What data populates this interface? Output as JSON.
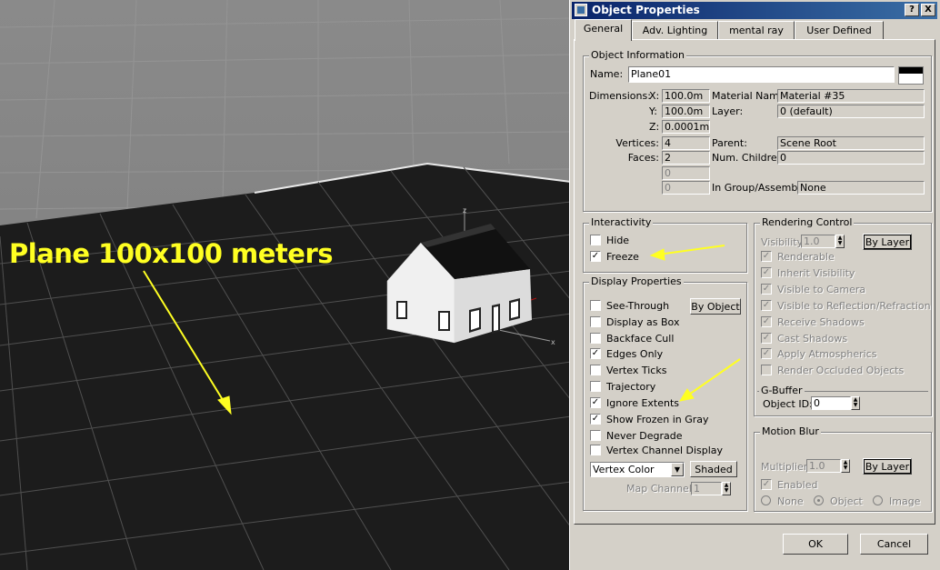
{
  "annotation": {
    "text": "Plane 100x100 meters"
  },
  "dialog": {
    "title": "Object Properties",
    "help_button": "?",
    "close_button": "X",
    "tabs": [
      "General",
      "Adv. Lighting",
      "mental ray",
      "User Defined"
    ],
    "object_information": {
      "title": "Object Information",
      "name_label": "Name:",
      "name_value": "Plane01",
      "dimensions_label": "Dimensions:",
      "x_label": "X:",
      "x_value": "100.0m",
      "y_label": "Y:",
      "y_value": "100.0m",
      "z_label": "Z:",
      "z_value": "0.0001m",
      "material_name_label": "Material Name:",
      "material_name_value": "Material #35",
      "layer_label": "Layer:",
      "layer_value": "0 (default)",
      "vertices_label": "Vertices:",
      "vertices_value": "4",
      "faces_label": "Faces:",
      "faces_value": "2",
      "blank1_value": "0",
      "blank2_value": "0",
      "parent_label": "Parent:",
      "parent_value": "Scene Root",
      "num_children_label": "Num. Children:",
      "num_children_value": "0",
      "in_group_label": "In Group/Assembly:",
      "in_group_value": "None"
    },
    "interactivity": {
      "title": "Interactivity",
      "items": [
        {
          "label": "Hide",
          "checked": false
        },
        {
          "label": "Freeze",
          "checked": true
        }
      ]
    },
    "display_properties": {
      "title": "Display Properties",
      "by_object_button": "By Object",
      "items": [
        {
          "label": "See-Through",
          "checked": false
        },
        {
          "label": "Display as Box",
          "checked": false
        },
        {
          "label": "Backface Cull",
          "checked": false
        },
        {
          "label": "Edges Only",
          "checked": true
        },
        {
          "label": "Vertex Ticks",
          "checked": false
        },
        {
          "label": "Trajectory",
          "checked": false
        },
        {
          "label": "Ignore Extents",
          "checked": true
        },
        {
          "label": "Show Frozen in Gray",
          "checked": true
        },
        {
          "label": "Never Degrade",
          "checked": false
        },
        {
          "label": "Vertex Channel Display",
          "checked": false
        }
      ],
      "vertex_color_value": "Vertex Color",
      "shaded_button": "Shaded",
      "map_channel_label": "Map Channel:",
      "map_channel_value": "1"
    },
    "rendering_control": {
      "title": "Rendering Control",
      "visibility_label": "Visibility:",
      "visibility_value": "1.0",
      "by_layer_button": "By Layer",
      "items": [
        {
          "label": "Renderable",
          "checked": true
        },
        {
          "label": "Inherit Visibility",
          "checked": true
        },
        {
          "label": "Visible to Camera",
          "checked": true
        },
        {
          "label": "Visible to Reflection/Refraction",
          "checked": true
        },
        {
          "label": "Receive Shadows",
          "checked": true
        },
        {
          "label": "Cast Shadows",
          "checked": true
        },
        {
          "label": "Apply Atmospherics",
          "checked": true
        },
        {
          "label": "Render Occluded Objects",
          "checked": false
        }
      ]
    },
    "g_buffer": {
      "title": "G-Buffer",
      "object_id_label": "Object ID:",
      "object_id_value": "0"
    },
    "motion_blur": {
      "title": "Motion Blur",
      "multiplier_label": "Multiplier:",
      "multiplier_value": "1.0",
      "by_layer_button": "By Layer",
      "enabled_label": "Enabled",
      "options": [
        "None",
        "Object",
        "Image"
      ],
      "selected": "Object"
    },
    "ok_button": "OK",
    "cancel_button": "Cancel"
  },
  "colors": {
    "title_bar": "#0a246a",
    "dialog_bg": "#d4d0c8",
    "annotation": "#ffff22",
    "floor": "#1c1c1c"
  }
}
